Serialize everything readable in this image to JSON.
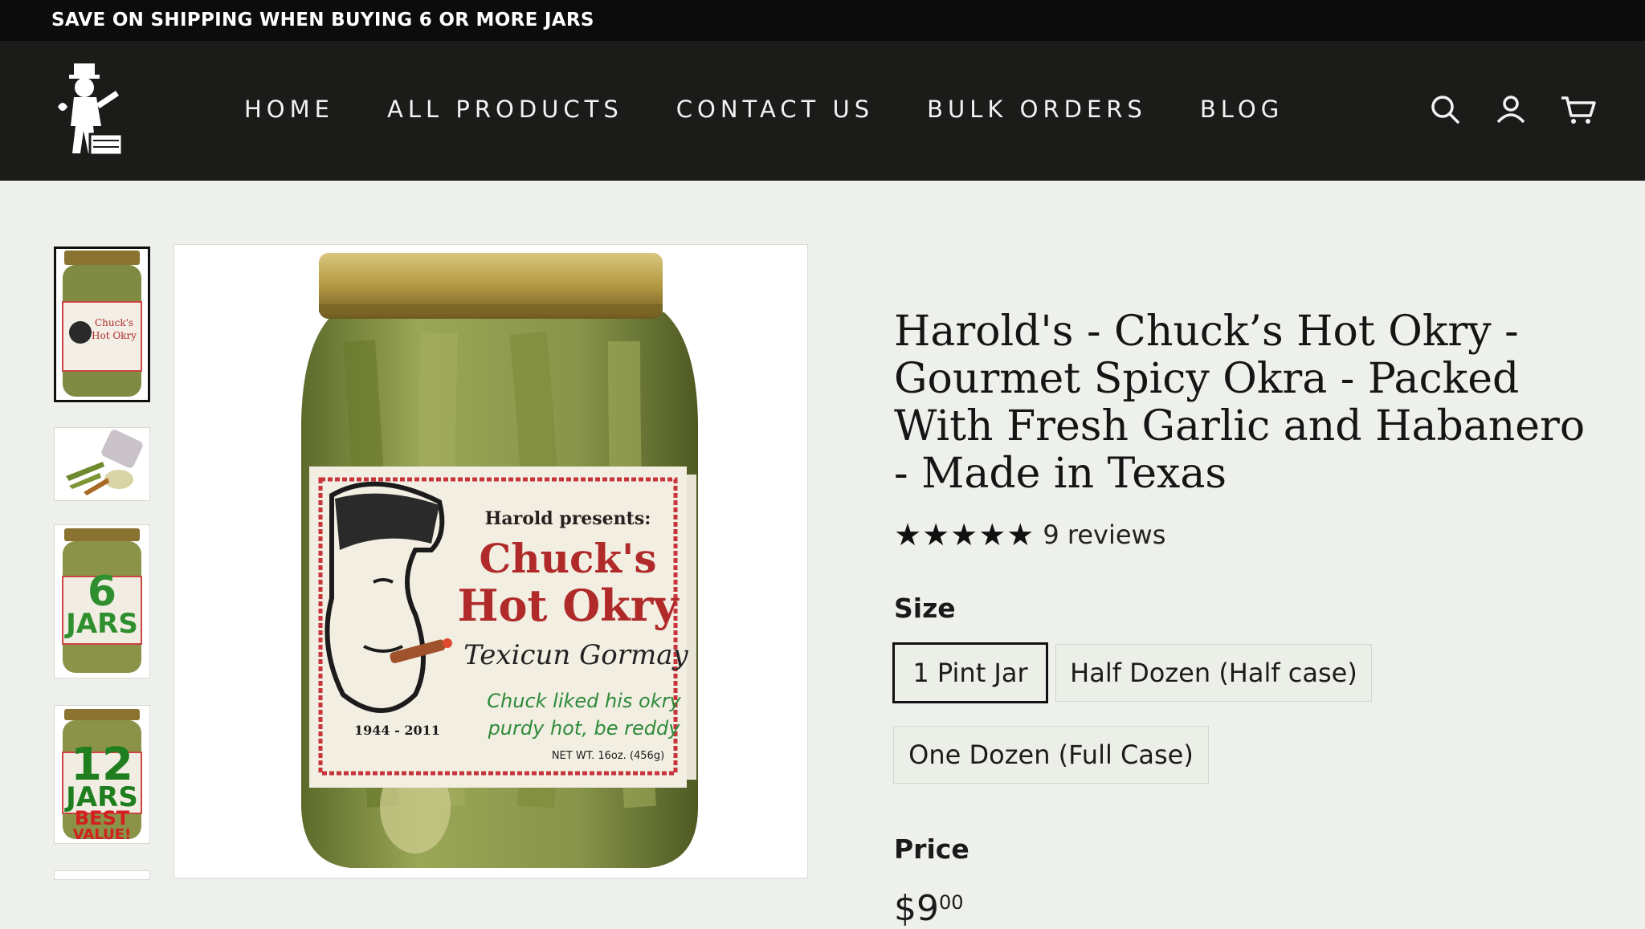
{
  "announcement": "SAVE ON SHIPPING WHEN BUYING 6 OR MORE JARS",
  "nav": [
    "HOME",
    "ALL PRODUCTS",
    "CONTACT US",
    "BULK ORDERS",
    "BLOG"
  ],
  "header_icons": [
    "search-icon",
    "account-icon",
    "cart-icon"
  ],
  "thumbnails": [
    {
      "name": "single jar"
    },
    {
      "name": "jar spilled"
    },
    {
      "line1": "6",
      "line2": "JARS"
    },
    {
      "line1": "12",
      "line2": "JARS",
      "line3": "BEST",
      "line4": "VALUE!"
    }
  ],
  "jar_label": {
    "presents": "Harold presents:",
    "line1": "Chuck's",
    "line2": "Hot Okry",
    "script": "Texicun Gormay",
    "note1": "Chuck liked his okry",
    "note2": "purdy hot, be reddy",
    "years": "1944 - 2011",
    "weight": "NET WT. 16oz. (456g)"
  },
  "product": {
    "title": "Harold's - Chuck’s Hot Okry - Gourmet Spicy Okra - Packed With Fresh Garlic and Habanero - Made in Texas",
    "stars": "★★★★★",
    "rating": 5,
    "reviews": "9 reviews",
    "size_label": "Size",
    "sizes": [
      "1 Pint Jar",
      "Half Dozen (Half case)",
      "One Dozen (Full Case)"
    ],
    "selected_size": "1 Pint Jar",
    "price_label": "Price",
    "price_whole": "$9",
    "price_cents": "00"
  },
  "colors": {
    "topbar": "#0c0c0c",
    "header": "#1b1b19",
    "page_bg": "#eef0eb",
    "label_red": "#b02a2a",
    "label_green": "#2e8b3a"
  }
}
